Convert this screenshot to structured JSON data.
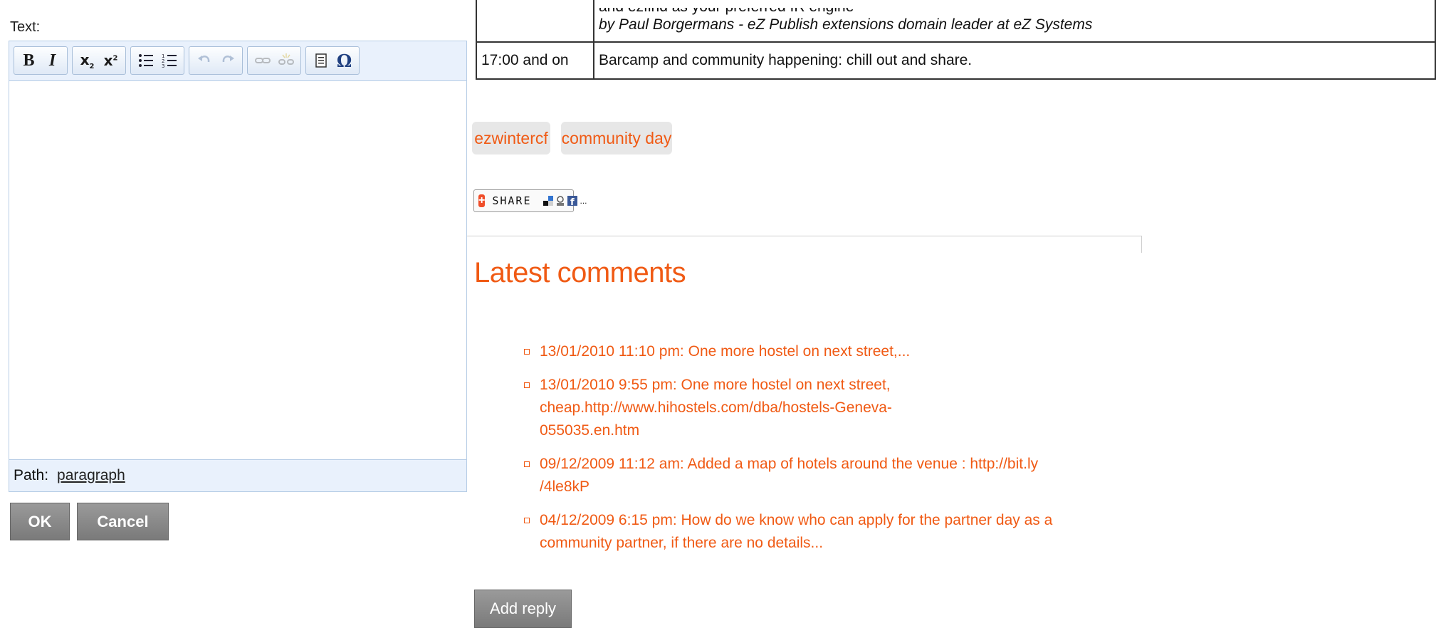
{
  "editor": {
    "label": "Text:",
    "toolbar": {
      "bold": "B",
      "italic": "I",
      "subscript_icon": "subscript-icon",
      "superscript_icon": "superscript-icon",
      "bullet_list_icon": "bullet-list-icon",
      "numbered_list_icon": "numbered-list-icon",
      "undo_icon": "undo-icon",
      "redo_icon": "redo-icon",
      "link_icon": "link-icon",
      "unlink_icon": "unlink-icon",
      "paste_text_icon": "paste-text-icon",
      "special_char": "Ω"
    },
    "path_label": "Path:",
    "path_value": "paragraph",
    "ok_label": "OK",
    "cancel_label": "Cancel"
  },
  "schedule": {
    "rows": [
      {
        "time": "",
        "talk_partial": "and ezfind as your preferred IR engine",
        "speaker": "by Paul Borgermans - eZ Publish extensions domain leader at eZ Systems"
      },
      {
        "time": "17:00 and on",
        "talk": "Barcamp and community happening: chill out and share."
      }
    ]
  },
  "tags": [
    "ezwintercf",
    "community day"
  ],
  "share": {
    "label": "SHARE",
    "icons": [
      "addthis-plus-icon",
      "delicious-icon",
      "digg-icon",
      "facebook-icon"
    ],
    "more": "..."
  },
  "comments": {
    "title": "Latest comments",
    "items": [
      "13/01/2010 11:10 pm: One more hostel on next street,...",
      "13/01/2010 9:55 pm: One more hostel on next street, cheap.http://www.hihostels.com/dba/hostels-Geneva-055035.en.htm",
      "09/12/2009 11:12 am: Added a map of hotels around the venue : http://bit.ly /4le8kP",
      "04/12/2009 6:15 pm: How do we know who can apply for the partner day as a community partner, if there are no details..."
    ],
    "add_reply_label": "Add reply"
  },
  "colors": {
    "accent": "#f05a14",
    "toolbar_bg": "#e9f1fc",
    "button_gray": "#8a8a8a"
  }
}
